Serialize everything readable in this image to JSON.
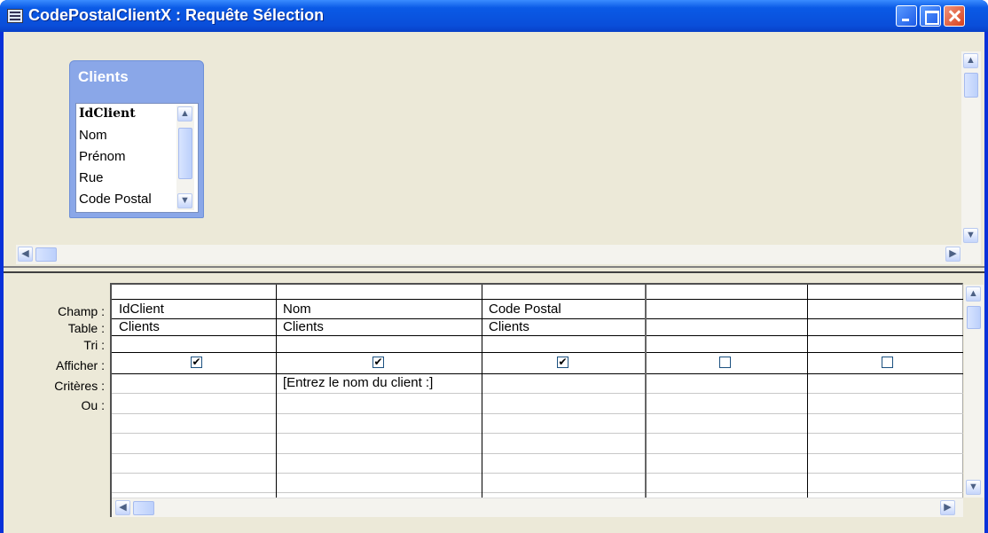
{
  "window": {
    "title": "CodePostalClientX : Requête Sélection"
  },
  "table": {
    "name": "Clients",
    "fields": [
      "IdClient",
      "Nom",
      "Prénom",
      "Rue",
      "Code Postal"
    ]
  },
  "grid": {
    "row_labels": [
      "Champ :",
      "Table :",
      "Tri :",
      "Afficher :",
      "Critères :",
      "Ou :"
    ],
    "columns": [
      {
        "champ": "IdClient",
        "table": "Clients",
        "tri": "",
        "afficher": true,
        "criteres": "",
        "ou": ""
      },
      {
        "champ": "Nom",
        "table": "Clients",
        "tri": "",
        "afficher": true,
        "criteres": "[Entrez le nom du client :]",
        "ou": ""
      },
      {
        "champ": "Code Postal",
        "table": "Clients",
        "tri": "",
        "afficher": true,
        "criteres": "",
        "ou": ""
      },
      {
        "champ": "",
        "table": "",
        "tri": "",
        "afficher": false,
        "criteres": "",
        "ou": ""
      },
      {
        "champ": "",
        "table": "",
        "tri": "",
        "afficher": false,
        "criteres": "",
        "ou": ""
      }
    ]
  },
  "icons": {
    "check": "✔",
    "up": "▲",
    "down": "▼",
    "left": "◀",
    "right": "▶"
  }
}
